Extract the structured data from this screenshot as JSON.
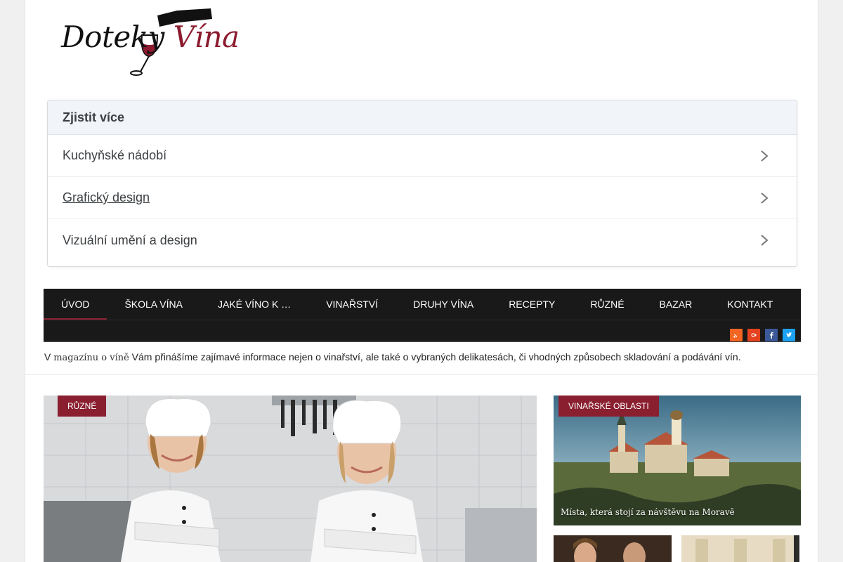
{
  "logo": {
    "text_main": "Doteky ",
    "text_accent": "Vína"
  },
  "accordion": {
    "title": "Zjistit více",
    "items": [
      {
        "label": "Kuchyňské nádobí"
      },
      {
        "label": "Grafický design"
      },
      {
        "label": "Vizuální umění a design"
      }
    ]
  },
  "nav": {
    "items": [
      {
        "label": "Úvod",
        "active": true
      },
      {
        "label": "Škola vína"
      },
      {
        "label": "Jaké víno k …"
      },
      {
        "label": "Vinařství"
      },
      {
        "label": "Druhy vína"
      },
      {
        "label": "Recepty"
      },
      {
        "label": "Různé"
      },
      {
        "label": "Bazar"
      },
      {
        "label": "Kontakt"
      }
    ],
    "socials": [
      {
        "name": "rss-icon",
        "color": "#f26522"
      },
      {
        "name": "google-plus-icon",
        "color": "#e5421f"
      },
      {
        "name": "facebook-icon",
        "color": "#3b5998"
      },
      {
        "name": "twitter-icon",
        "color": "#1da1f2"
      }
    ]
  },
  "tagline": {
    "prefix": "V ",
    "link": "magazínu o víně",
    "rest": " Vám přinášíme zajímavé informace nejen o vinařství, ale také o vybraných delikatesách, či vhodných způsobech skladování a podávání vín."
  },
  "featured": {
    "main_category": "Různé",
    "side_category": "Vinařské oblasti",
    "side_title": "Místa, která stojí za návštěvu na Moravě"
  },
  "colors": {
    "accent": "#8a1f30",
    "nav_bg": "#191919"
  }
}
